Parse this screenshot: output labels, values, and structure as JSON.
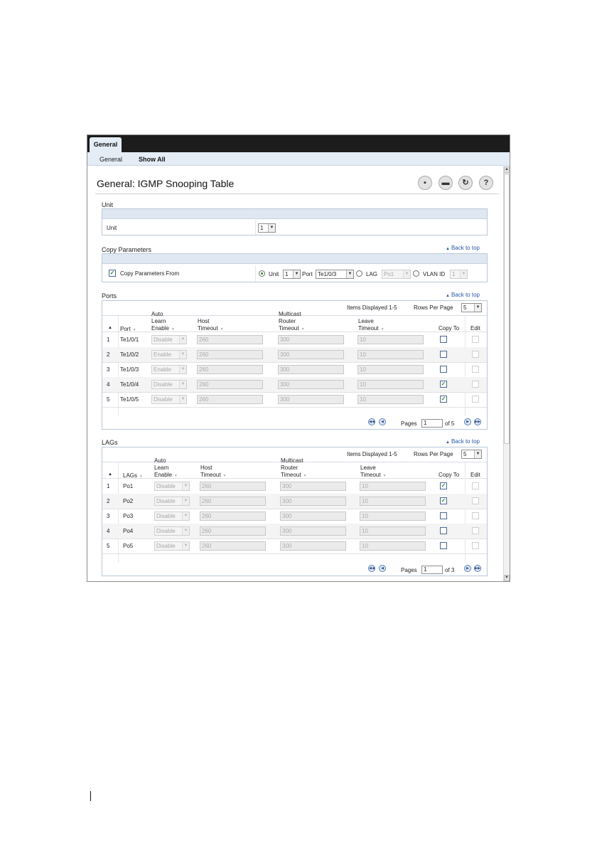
{
  "tabs": {
    "active": "General"
  },
  "subnav": {
    "items": [
      "General",
      "Show All"
    ]
  },
  "title": "General: IGMP Snooping Table",
  "toolbar": {
    "save": "save-icon",
    "print": "print-icon",
    "refresh": "refresh-icon",
    "help": "help-icon"
  },
  "unit_section": {
    "label": "Unit",
    "row_label": "Unit",
    "value": "1"
  },
  "copy_section": {
    "label": "Copy Parameters",
    "back_to_top": "Back to top",
    "checkbox_label": "Copy Parameters From",
    "checked": true,
    "unit_label": "Unit",
    "unit_value": "1",
    "port_label": "Port",
    "port_value": "Te1/0/3",
    "lag_label": "LAG",
    "lag_value": "Po1",
    "vlan_label": "VLAN ID",
    "vlan_value": "1",
    "selected_option": "Unit"
  },
  "ports": {
    "label": "Ports",
    "back_to_top": "Back to top",
    "items_displayed": "Items Displayed 1-5",
    "rows_per_page_label": "Rows Per Page",
    "rows_per_page": "5",
    "columns": {
      "port": "Port",
      "auto_learn": [
        "Auto",
        "Learn",
        "Enable"
      ],
      "host_timeout": [
        "Host",
        "Timeout"
      ],
      "mrouter_timeout": [
        "Multicast",
        "Router",
        "Timeout"
      ],
      "leave_timeout": [
        "Leave",
        "Timeout"
      ],
      "copy_to": "Copy To",
      "edit": "Edit"
    },
    "rows": [
      {
        "num": "1",
        "name": "Te1/0/1",
        "auto_learn": "Disable",
        "host": "260",
        "mrouter": "300",
        "leave": "10",
        "copy_to": false
      },
      {
        "num": "2",
        "name": "Te1/0/2",
        "auto_learn": "Enable",
        "host": "260",
        "mrouter": "300",
        "leave": "10",
        "copy_to": false
      },
      {
        "num": "3",
        "name": "Te1/0/3",
        "auto_learn": "Enable",
        "host": "260",
        "mrouter": "300",
        "leave": "10",
        "copy_to": false
      },
      {
        "num": "4",
        "name": "Te1/0/4",
        "auto_learn": "Disable",
        "host": "260",
        "mrouter": "300",
        "leave": "10",
        "copy_to": true
      },
      {
        "num": "5",
        "name": "Te1/0/5",
        "auto_learn": "Disable",
        "host": "260",
        "mrouter": "300",
        "leave": "10",
        "copy_to": true
      }
    ],
    "pages_label": "Pages",
    "page": "1",
    "of_pages": "of 5"
  },
  "lags": {
    "label": "LAGs",
    "back_to_top": "Back to top",
    "items_displayed": "Items Displayed 1-5",
    "rows_per_page_label": "Rows Per Page",
    "rows_per_page": "5",
    "columns": {
      "lag": "LAGs",
      "auto_learn": [
        "Auto",
        "Learn",
        "Enable"
      ],
      "host_timeout": [
        "Host",
        "Timeout"
      ],
      "mrouter_timeout": [
        "Multicast",
        "Router",
        "Timeout"
      ],
      "leave_timeout": [
        "Leave",
        "Timeout"
      ],
      "copy_to": "Copy To",
      "edit": "Edit"
    },
    "rows": [
      {
        "num": "1",
        "name": "Po1",
        "auto_learn": "Disable",
        "host": "260",
        "mrouter": "300",
        "leave": "10",
        "copy_to": true
      },
      {
        "num": "2",
        "name": "Po2",
        "auto_learn": "Disable",
        "host": "260",
        "mrouter": "300",
        "leave": "10",
        "copy_to": true
      },
      {
        "num": "3",
        "name": "Po3",
        "auto_learn": "Disable",
        "host": "260",
        "mrouter": "300",
        "leave": "10",
        "copy_to": false
      },
      {
        "num": "4",
        "name": "Po4",
        "auto_learn": "Disable",
        "host": "260",
        "mrouter": "300",
        "leave": "10",
        "copy_to": false
      },
      {
        "num": "5",
        "name": "Po5",
        "auto_learn": "Disable",
        "host": "260",
        "mrouter": "300",
        "leave": "10",
        "copy_to": false
      }
    ],
    "pages_label": "Pages",
    "page": "1",
    "of_pages": "of 3"
  }
}
